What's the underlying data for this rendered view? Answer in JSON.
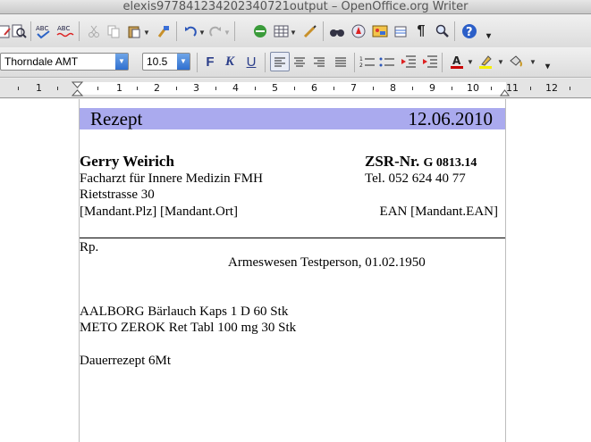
{
  "window": {
    "title": "elexis977841234202340721output – OpenOffice.org Writer"
  },
  "toolbar": {
    "font_name": "Thorndale AMT",
    "font_size": "10.5",
    "bold_label": "F",
    "italic_label": "K",
    "underline_label": "U",
    "help_label": "?"
  },
  "ruler": {
    "numbers": [
      "1",
      "1",
      "2",
      "3",
      "4",
      "5",
      "6",
      "7",
      "8",
      "9",
      "10",
      "11",
      "12"
    ]
  },
  "document": {
    "header_left": "Rezept",
    "header_date": "12.06.2010",
    "doctor_name": "Gerry Weirich",
    "doctor_title": "Facharzt für Innere Medizin FMH",
    "street": "Rietstrasse 30",
    "mandant_place": "[Mandant.Plz] [Mandant.Ort]",
    "zsr_label": "ZSR-Nr.",
    "zsr_number": "G 0813.14",
    "phone": "Tel. 052 624 40 77",
    "ean": "EAN [Mandant.EAN]",
    "rp": "Rp.",
    "patient": "Armeswesen Testperson, 01.02.1950",
    "med1": "AALBORG Bärlauch Kaps 1 D 60 Stk",
    "med2": "METO ZEROK Ret Tabl 100 mg 30 Stk",
    "note": "Dauerrezept 6Mt"
  }
}
